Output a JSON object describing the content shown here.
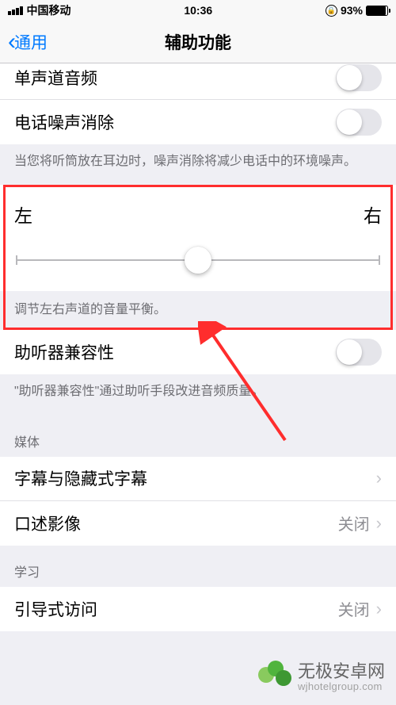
{
  "status": {
    "carrier": "中国移动",
    "time": "10:36",
    "battery_pct": "93%"
  },
  "nav": {
    "back_label": "通用",
    "title": "辅助功能"
  },
  "rows": {
    "mono_audio": "单声道音频",
    "noise_cancel": "电话噪声消除",
    "hearing_aid": "助听器兼容性",
    "subtitles": "字幕与隐藏式字幕",
    "audio_desc": "口述影像",
    "guided_access": "引导式访问"
  },
  "footers": {
    "noise_cancel": "当您将听筒放在耳边时，噪声消除将减少电话中的环境噪声。",
    "balance": "调节左右声道的音量平衡。",
    "hearing_aid": "\"助听器兼容性\"通过助听手段改进音频质量。"
  },
  "headers": {
    "media": "媒体",
    "learning": "学习"
  },
  "balance": {
    "left": "左",
    "right": "右"
  },
  "values": {
    "off": "关闭"
  },
  "watermark": {
    "title": "无极安卓网",
    "url": "wjhotelgroup.com"
  }
}
